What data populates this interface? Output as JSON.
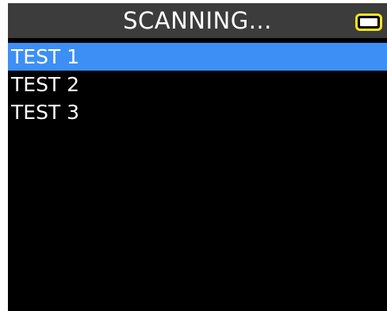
{
  "header": {
    "title": "SCANNING...",
    "battery_icon": "battery-icon"
  },
  "menu": {
    "items": [
      {
        "label": "TEST 1",
        "selected": true
      },
      {
        "label": "TEST 2",
        "selected": false
      },
      {
        "label": "TEST 3",
        "selected": false
      }
    ]
  },
  "colors": {
    "selection": "#3d8ff5",
    "header_bg": "#3c3c3c",
    "battery": "#f6e61c",
    "screen_bg": "#000000"
  }
}
